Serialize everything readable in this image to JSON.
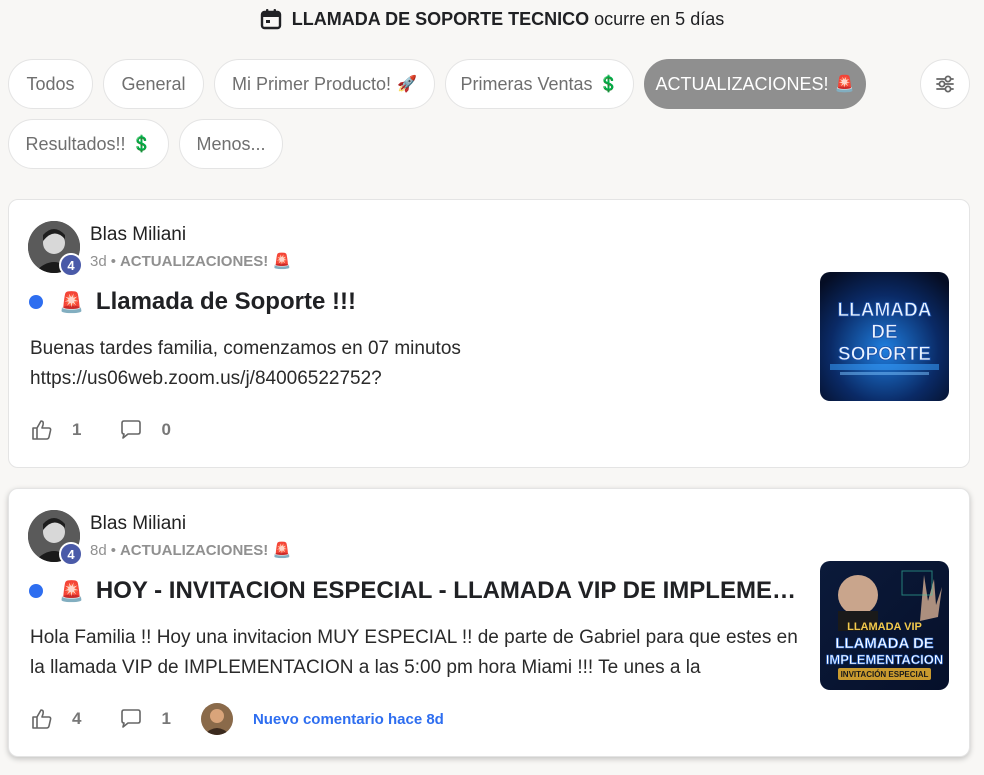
{
  "event": {
    "title": "LLAMADA DE SOPORTE TECNICO",
    "suffix": "ocurre en 5 días"
  },
  "chips": [
    {
      "label": "Todos",
      "emoji": ""
    },
    {
      "label": "General",
      "emoji": ""
    },
    {
      "label": "Mi Primer Producto!",
      "emoji": "🚀"
    },
    {
      "label": "Primeras Ventas",
      "emoji": "💲"
    },
    {
      "label": "ACTUALIZACIONES!",
      "emoji": "🚨"
    },
    {
      "label": "Resultados!!",
      "emoji": "💲"
    },
    {
      "label": "Menos...",
      "emoji": ""
    }
  ],
  "active_chip": "ACTUALIZACIONES!",
  "posts": [
    {
      "author": "Blas Miliani",
      "level": "4",
      "age": "3d",
      "category": "ACTUALIZACIONES!",
      "category_emoji": "🚨",
      "title_emoji": "🚨",
      "title": "Llamada de Soporte !!!",
      "body": "Buenas tardes familia, comenzamos en 07 minutos https://us06web.zoom.us/j/84006522752?",
      "likes": "1",
      "comments": "0",
      "thumb_lines": [
        "LLAMADA",
        "DE",
        "SOPORTE"
      ]
    },
    {
      "author": "Blas Miliani",
      "level": "4",
      "age": "8d",
      "category": "ACTUALIZACIONES!",
      "category_emoji": "🚨",
      "title_emoji": "🚨",
      "title": "HOY - INVITACION ESPECIAL - LLAMADA VIP DE IMPLEMENTACION",
      "body": "Hola Familia !! Hoy una invitacion MUY ESPECIAL !! de parte de Gabriel para que estes en la llamada VIP de IMPLEMENTACION a las 5:00 pm hora Miami !!! Te unes a la",
      "likes": "4",
      "comments": "1",
      "new_comment": "Nuevo comentario hace 8d",
      "thumb_lines": [
        "LLAMADA VIP",
        "LLAMADA DE",
        "IMPLEMENTACION",
        "INVITACIÓN ESPECIAL"
      ]
    }
  ],
  "colors": {
    "accent_blue": "#2e6ef0",
    "active_chip": "#8f8f8f",
    "level_badge": "#4a5aa8"
  }
}
